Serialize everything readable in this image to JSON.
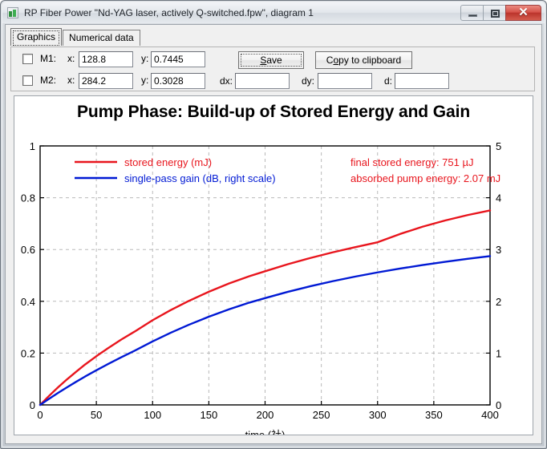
{
  "window": {
    "title": "RP Fiber Power \"Nd-YAG laser, actively Q-switched.fpw\", diagram 1",
    "icon": "app-icon",
    "buttons": {
      "minimize": "minimize-icon",
      "maximize": "maximize-icon",
      "close": "✕"
    }
  },
  "tabs": [
    {
      "label": "Graphics",
      "selected": true
    },
    {
      "label": "Numerical data",
      "selected": false
    }
  ],
  "controls": {
    "m1": {
      "checkbox_label": "M1:",
      "checked": false,
      "x_label": "x:",
      "x_value": "128.8",
      "y_label": "y:",
      "y_value": "0.7445"
    },
    "m2": {
      "checkbox_label": "M2:",
      "checked": false,
      "x_label": "x:",
      "x_value": "284.2",
      "y_label": "y:",
      "y_value": "0.3028"
    },
    "save_button": "Save",
    "save_button_pre": "S",
    "save_button_post": "ave",
    "copy_button_pre": "C",
    "copy_button_mid": "o",
    "copy_button_post": "py to clipboard",
    "copy_button": "Copy to clipboard",
    "dx_label": "dx:",
    "dx_value": "",
    "dy_label": "dy:",
    "dy_value": "",
    "d_label": "d:",
    "d_value": ""
  },
  "chart_data": {
    "type": "line",
    "title": "Pump Phase: Build-up of Stored Energy and Gain",
    "xlabel": "time (社)",
    "ylabel": "",
    "xlim": [
      0,
      400
    ],
    "ylim": [
      0,
      1
    ],
    "y2lim": [
      0,
      5
    ],
    "xticks": [
      0,
      50,
      100,
      150,
      200,
      250,
      300,
      350,
      400
    ],
    "yticks": [
      0,
      0.2,
      0.4,
      0.6,
      0.8,
      1
    ],
    "y2ticks": [
      0,
      1,
      2,
      3,
      4,
      5
    ],
    "grid": true,
    "legend_position": "top-left",
    "colors": {
      "stored_energy": "#e8151d",
      "gain": "#0019d4",
      "annotation": "#e8151d",
      "grid": "#b9b9b9"
    },
    "annotations": [
      "final stored energy: 751 µJ",
      "absorbed pump energy: 2.07 mJ"
    ],
    "x": [
      0,
      8,
      16,
      24,
      32,
      40,
      50,
      60,
      72,
      84,
      100,
      116,
      132,
      150,
      168,
      186,
      200,
      220,
      240,
      260,
      280,
      300,
      320,
      340,
      360,
      380,
      400
    ],
    "series": [
      {
        "name": "stored energy (mJ)",
        "axis": "left",
        "color": "#e8151d",
        "values": [
          0.0,
          0.035,
          0.068,
          0.099,
          0.128,
          0.156,
          0.188,
          0.218,
          0.252,
          0.283,
          0.327,
          0.366,
          0.401,
          0.437,
          0.469,
          0.497,
          0.516,
          0.543,
          0.567,
          0.589,
          0.609,
          0.628,
          0.66,
          0.688,
          0.712,
          0.733,
          0.751
        ]
      },
      {
        "name": "single-pass gain (dB, right scale)",
        "axis": "right",
        "color": "#0019d4",
        "values": [
          0.0,
          0.118,
          0.232,
          0.341,
          0.446,
          0.548,
          0.668,
          0.784,
          0.918,
          1.046,
          1.226,
          1.392,
          1.545,
          1.703,
          1.846,
          1.975,
          2.062,
          2.182,
          2.29,
          2.388,
          2.477,
          2.558,
          2.632,
          2.7,
          2.763,
          2.82,
          2.873
        ]
      }
    ]
  }
}
